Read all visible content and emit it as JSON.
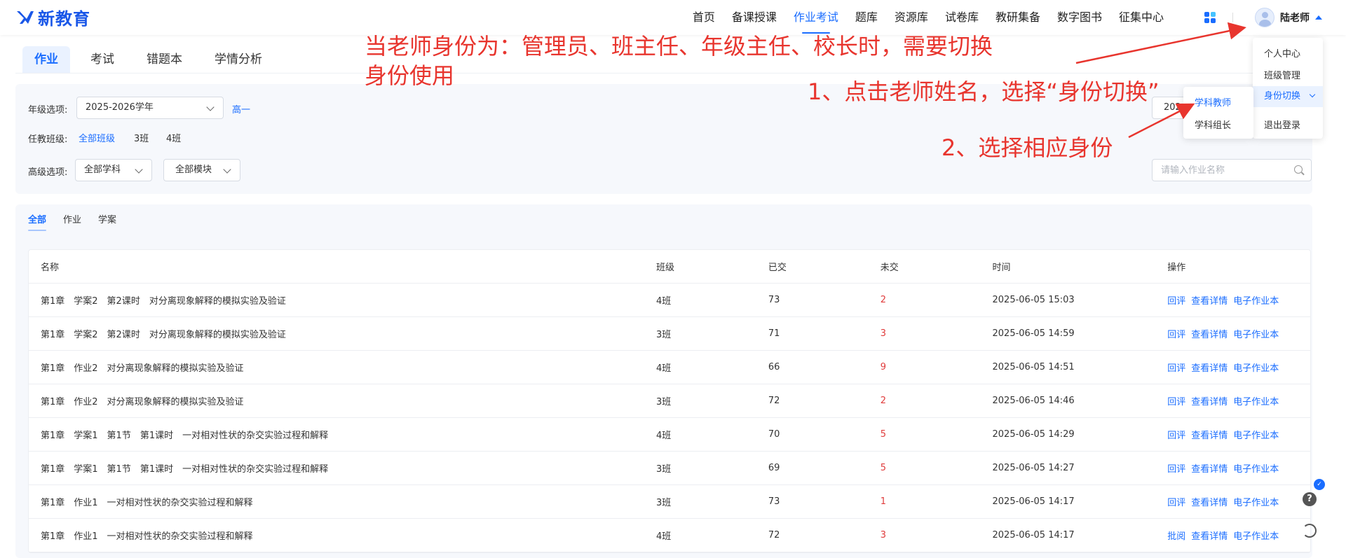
{
  "brand": {
    "logo_text": "新教育",
    "accent": "#1a6dff",
    "annotation_color": "#e8352e"
  },
  "nav": {
    "items": [
      "首页",
      "备课授课",
      "作业考试",
      "题库",
      "资源库",
      "试卷库",
      "教研集备",
      "数字图书",
      "征集中心"
    ],
    "active_index": 2,
    "apps_icon": "apps-grid-icon"
  },
  "user": {
    "name": "陆老师"
  },
  "user_menu": {
    "items": [
      "个人中心",
      "班级管理",
      "身份切换",
      "退出登录"
    ],
    "highlighted": "身份切换",
    "submenu": [
      "学科教师",
      "学科组长"
    ],
    "submenu_active": "学科教师"
  },
  "top_tabs": {
    "items": [
      "作业",
      "考试",
      "错题本",
      "学情分析"
    ],
    "active_index": 0
  },
  "filters": {
    "grade_label": "年级选项:",
    "school_year": "2025-2026学年",
    "grade": "高一",
    "class_label": "任教班级:",
    "classes": [
      "全部班级",
      "3班",
      "4班"
    ],
    "class_active_index": 0,
    "advanced_label": "高级选项:",
    "subject": "全部学科",
    "module": "全部模块",
    "year_short": "202",
    "search_placeholder": "请输入作业名称"
  },
  "sub_tabs": {
    "items": [
      "全部",
      "作业",
      "学案"
    ],
    "active_index": 0
  },
  "table": {
    "headers": [
      "名称",
      "班级",
      "已交",
      "未交",
      "时间",
      "操作"
    ],
    "rows": [
      {
        "name": "第1章　学案2　第2课时　对分离现象解释的模拟实验及验证",
        "class": "4班",
        "submitted": "73",
        "unsubmitted": "2",
        "time": "2025-06-05 15:03",
        "ops": [
          "回评",
          "查看详情",
          "电子作业本"
        ]
      },
      {
        "name": "第1章　学案2　第2课时　对分离现象解释的模拟实验及验证",
        "class": "3班",
        "submitted": "71",
        "unsubmitted": "3",
        "time": "2025-06-05 14:59",
        "ops": [
          "回评",
          "查看详情",
          "电子作业本"
        ]
      },
      {
        "name": "第1章　作业2　对分离现象解释的模拟实验及验证",
        "class": "4班",
        "submitted": "66",
        "unsubmitted": "9",
        "time": "2025-06-05 14:51",
        "ops": [
          "回评",
          "查看详情",
          "电子作业本"
        ]
      },
      {
        "name": "第1章　作业2　对分离现象解释的模拟实验及验证",
        "class": "3班",
        "submitted": "72",
        "unsubmitted": "2",
        "time": "2025-06-05 14:46",
        "ops": [
          "回评",
          "查看详情",
          "电子作业本"
        ]
      },
      {
        "name": "第1章　学案1　第1节　第1课时　一对相对性状的杂交实验过程和解释",
        "class": "4班",
        "submitted": "70",
        "unsubmitted": "5",
        "time": "2025-06-05 14:29",
        "ops": [
          "回评",
          "查看详情",
          "电子作业本"
        ]
      },
      {
        "name": "第1章　学案1　第1节　第1课时　一对相对性状的杂交实验过程和解释",
        "class": "3班",
        "submitted": "69",
        "unsubmitted": "5",
        "time": "2025-06-05 14:27",
        "ops": [
          "回评",
          "查看详情",
          "电子作业本"
        ]
      },
      {
        "name": "第1章　作业1　一对相对性状的杂交实验过程和解释",
        "class": "3班",
        "submitted": "73",
        "unsubmitted": "1",
        "time": "2025-06-05 14:17",
        "ops": [
          "回评",
          "查看详情",
          "电子作业本"
        ]
      },
      {
        "name": "第1章　作业1　一对相对性状的杂交实验过程和解释",
        "class": "4班",
        "submitted": "72",
        "unsubmitted": "3",
        "time": "2025-06-05 14:17",
        "ops": [
          "批阅",
          "查看详情",
          "电子作业本"
        ]
      }
    ]
  },
  "annotations": {
    "note_line1": "当老师身份为：管理员、班主任、年级主任、校长时，需要切换",
    "note_line2": "身份使用",
    "step1": "1、点击老师姓名，选择“身份切换”",
    "step2": "2、选择相应身份"
  },
  "side_tools": {
    "help": "?",
    "icons": [
      "help-icon",
      "refresh-icon"
    ]
  }
}
